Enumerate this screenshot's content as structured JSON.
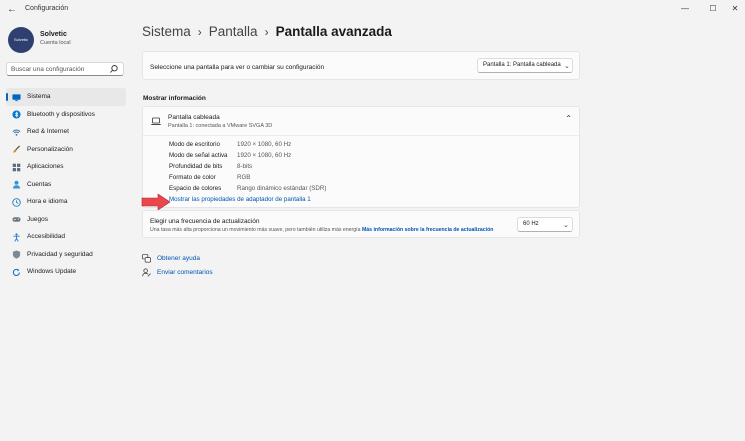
{
  "window": {
    "title": "Configuración",
    "back_glyph": "←",
    "minimize_glyph": "—",
    "maximize_glyph": "☐",
    "close_glyph": "✕"
  },
  "user": {
    "avatar_text": "Solvetic",
    "name": "Solvetic",
    "account_type": "Cuenta local"
  },
  "search": {
    "placeholder": "Buscar una configuración",
    "value": ""
  },
  "sidebar": {
    "items": [
      {
        "label": "Sistema",
        "icon": "monitor-icon",
        "color": "#0067c0",
        "active": true
      },
      {
        "label": "Bluetooth y dispositivos",
        "icon": "bluetooth-icon",
        "color": "#0078d4"
      },
      {
        "label": "Red & Internet",
        "icon": "wifi-icon",
        "color": "#3a6ea5"
      },
      {
        "label": "Personalización",
        "icon": "brush-icon",
        "color": "#d98b3a"
      },
      {
        "label": "Aplicaciones",
        "icon": "apps-icon",
        "color": "#5a6b7d"
      },
      {
        "label": "Cuentas",
        "icon": "person-icon",
        "color": "#2e9bd6"
      },
      {
        "label": "Hora e idioma",
        "icon": "globe-clock-icon",
        "color": "#1c7fc2"
      },
      {
        "label": "Juegos",
        "icon": "gamepad-icon",
        "color": "#6d7a86"
      },
      {
        "label": "Accesibilidad",
        "icon": "accessibility-icon",
        "color": "#2677c9"
      },
      {
        "label": "Privacidad y seguridad",
        "icon": "shield-icon",
        "color": "#7b8a96"
      },
      {
        "label": "Windows Update",
        "icon": "update-icon",
        "color": "#1a73c8"
      }
    ]
  },
  "breadcrumb": {
    "part1": "Sistema",
    "part2": "Pantalla",
    "current": "Pantalla avanzada",
    "separator": "›"
  },
  "display_select": {
    "label": "Seleccione una pantalla para ver o cambiar su configuración",
    "value": "Pantalla 1: Pantalla cableada"
  },
  "section": {
    "title": "Mostrar información"
  },
  "display_card": {
    "title": "Pantalla cableada",
    "subtitle": "Pantalla 1: conectada a VMware SVGA 3D",
    "rows": [
      {
        "key": "Modo de escritorio",
        "value": "1920 × 1080, 60 Hz"
      },
      {
        "key": "Modo de señal activa",
        "value": "1920 × 1080, 60 Hz"
      },
      {
        "key": "Profundidad de bits",
        "value": "8-bits"
      },
      {
        "key": "Formato de color",
        "value": "RGB"
      },
      {
        "key": "Espacio de colores",
        "value": "Rango dinámico estándar (SDR)"
      }
    ],
    "adapter_link": "Mostrar las propiedades de adaptador de pantalla 1"
  },
  "refresh": {
    "title": "Elegir una frecuencia de actualización",
    "description": "Una tasa más alta proporciona un movimiento más suave, pero también utiliza más energía",
    "link": "Más información sobre la frecuencia de actualización",
    "value": "60 Hz"
  },
  "help_links": {
    "help": "Obtener ayuda",
    "feedback": "Enviar comentarios"
  },
  "colors": {
    "accent": "#0067c0",
    "link": "#0055b3",
    "arrow": "#e8474b"
  }
}
